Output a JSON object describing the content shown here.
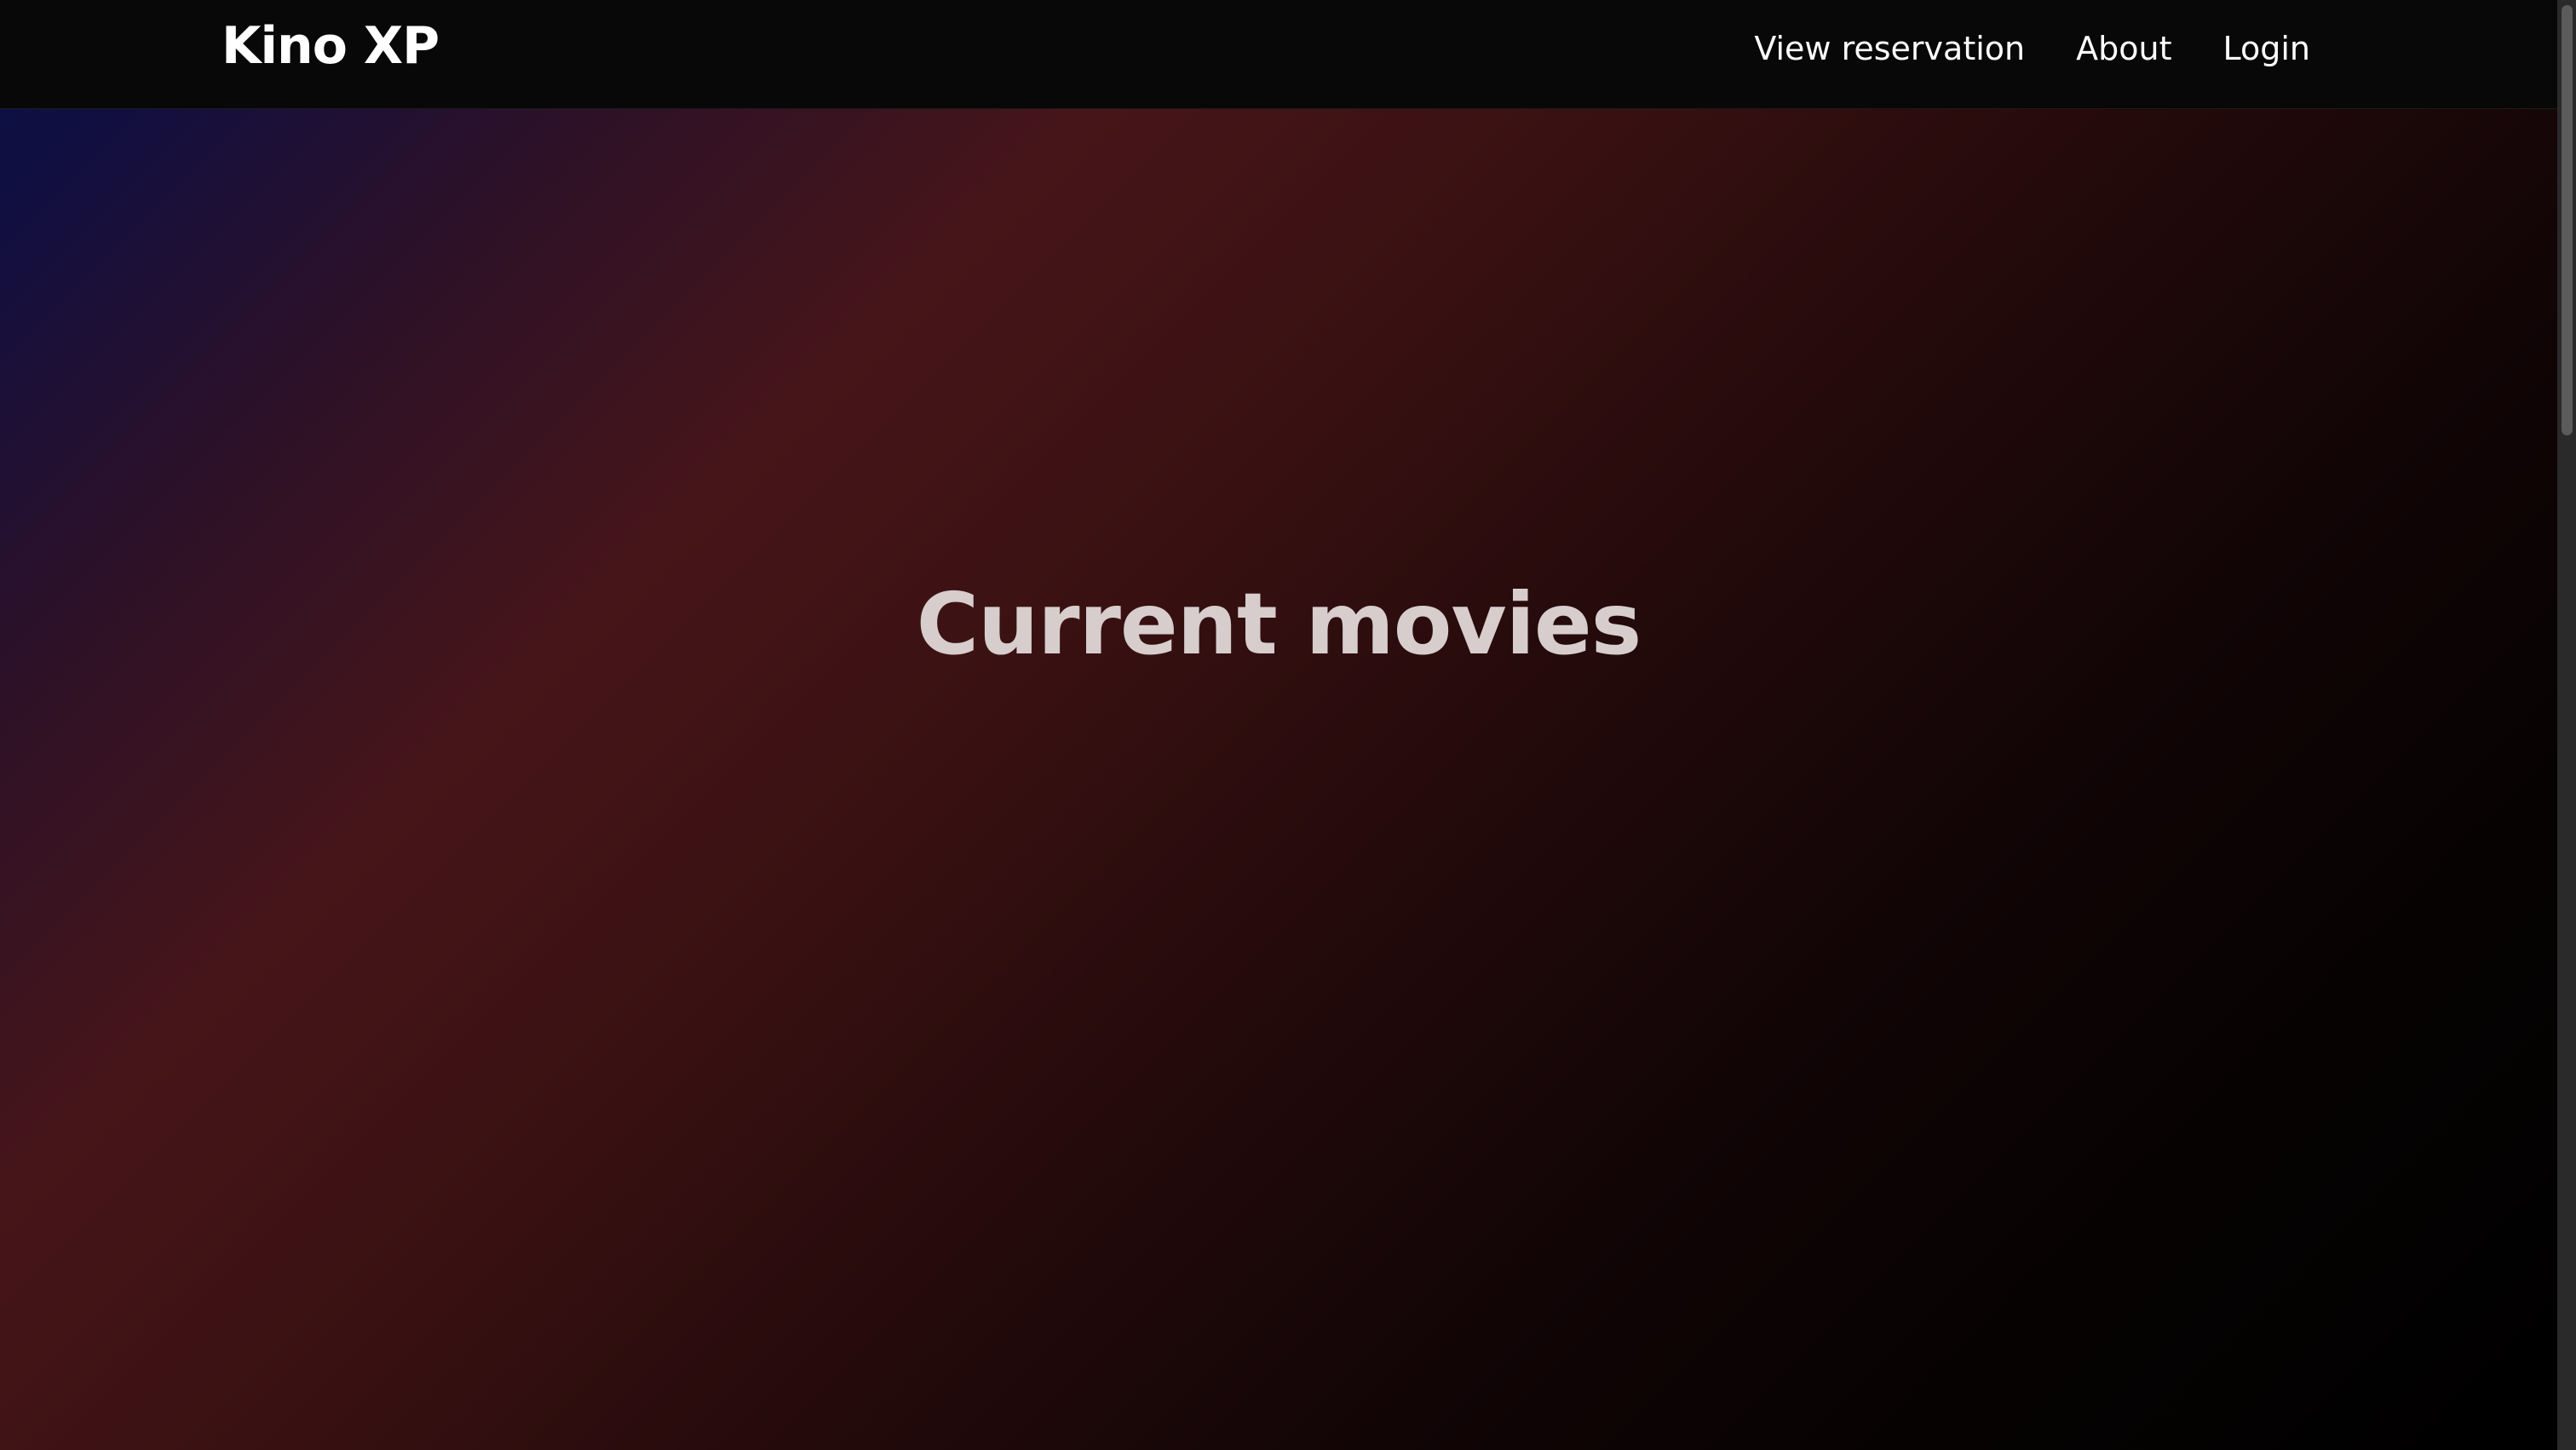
{
  "brand": {
    "title": "Kino XP"
  },
  "nav": {
    "items": [
      {
        "label": "View reservation"
      },
      {
        "label": "About"
      },
      {
        "label": "Login"
      }
    ]
  },
  "hero": {
    "title": "Current movies"
  },
  "colors": {
    "navbar_background": "#080808",
    "text_primary": "#ffffff",
    "hero_title": "#d7cdcd",
    "gradient_blue": "#0a1046",
    "gradient_red": "#461519",
    "gradient_black": "#000000"
  }
}
